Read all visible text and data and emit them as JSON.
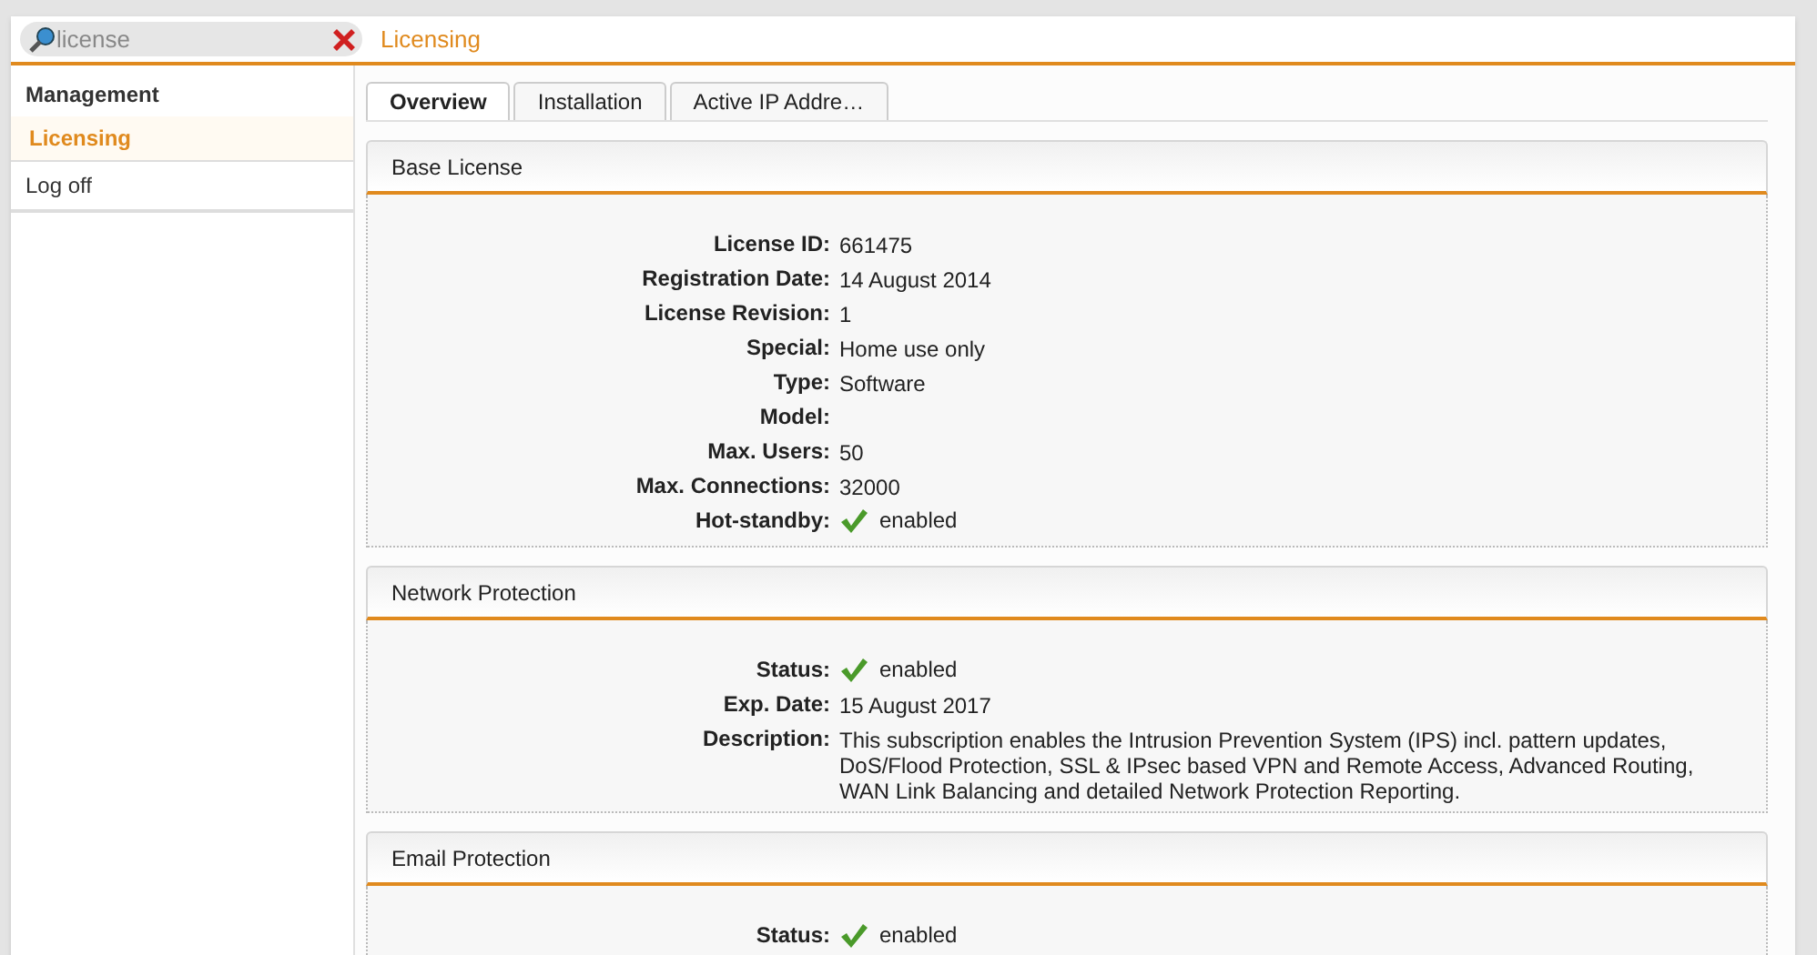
{
  "search": {
    "value": "license"
  },
  "breadcrumb": "Licensing",
  "sidebar": {
    "items": [
      {
        "label": "Management",
        "kind": "heading"
      },
      {
        "label": "Licensing",
        "kind": "item",
        "selected": true
      },
      {
        "label": "Log off",
        "kind": "item",
        "selected": false
      }
    ]
  },
  "tabs": [
    {
      "label": "Overview",
      "selected": true
    },
    {
      "label": "Installation",
      "selected": false
    },
    {
      "label": "Active IP Addre…",
      "selected": false
    }
  ],
  "panels": [
    {
      "title": "Base License",
      "rows": [
        {
          "label": "License ID:",
          "value": "661475",
          "kind": "text"
        },
        {
          "label": "Registration Date:",
          "value": "14 August 2014",
          "kind": "text"
        },
        {
          "label": "License Revision:",
          "value": "1",
          "kind": "text"
        },
        {
          "label": "Special:",
          "value": "Home use only",
          "kind": "text"
        },
        {
          "label": "Type:",
          "value": "Software",
          "kind": "text"
        },
        {
          "label": "Model:",
          "kind": "text"
        },
        {
          "label": "Max. Users:",
          "value": "50",
          "kind": "text"
        },
        {
          "label": "Max. Connections:",
          "value": "32000",
          "kind": "text"
        },
        {
          "label": "Hot-standby:",
          "value": "enabled",
          "kind": "status"
        }
      ]
    },
    {
      "title": "Network Protection",
      "rows": [
        {
          "label": "Status:",
          "value": "enabled",
          "kind": "status"
        },
        {
          "label": "Exp. Date:",
          "value": "15 August 2017",
          "kind": "text"
        },
        {
          "label": "Description:",
          "value": "This subscription enables the Intrusion Prevention System (IPS) incl. pattern updates, DoS/Flood Protection, SSL & IPsec based VPN and Remote Access, Advanced Routing, WAN Link Balancing and detailed Network Protection Reporting.",
          "kind": "text"
        }
      ]
    },
    {
      "title": "Email Protection",
      "rows": [
        {
          "label": "Status:",
          "value": "enabled",
          "kind": "status"
        }
      ]
    }
  ]
}
